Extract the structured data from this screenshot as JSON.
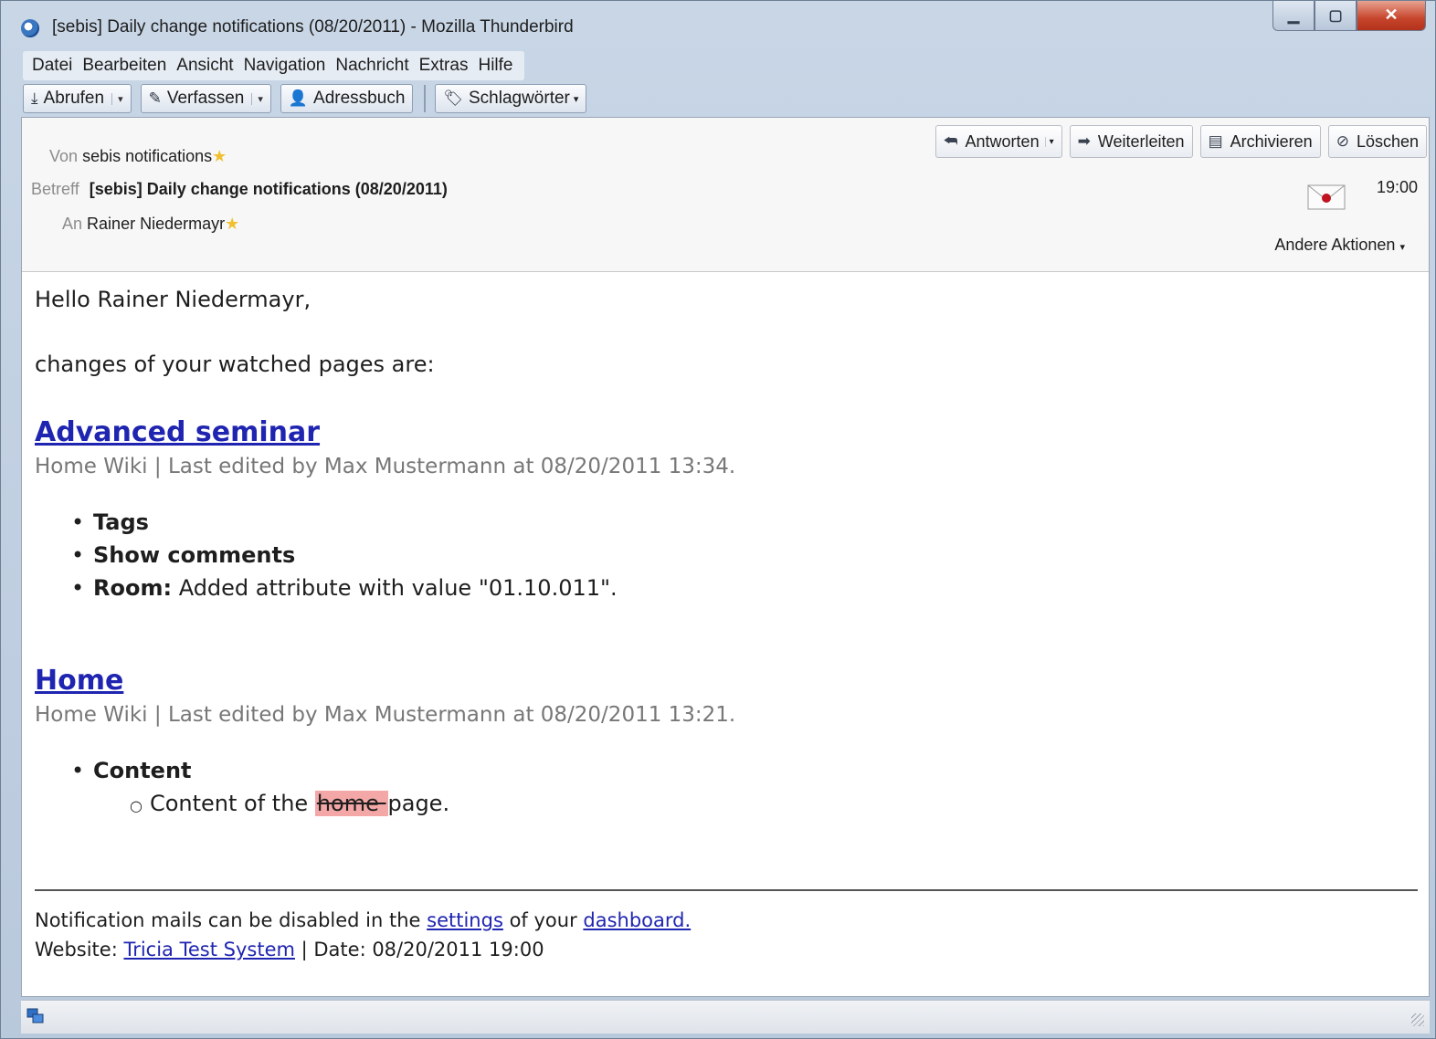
{
  "window": {
    "title": "[sebis] Daily change notifications (08/20/2011) - Mozilla Thunderbird"
  },
  "menubar": [
    "Datei",
    "Bearbeiten",
    "Ansicht",
    "Navigation",
    "Nachricht",
    "Extras",
    "Hilfe"
  ],
  "toolbar": {
    "get_mail": "Abrufen",
    "compose": "Verfassen",
    "address_book": "Adressbuch",
    "tags": "Schlagwörter"
  },
  "header": {
    "from_label": "Von",
    "from_value": "sebis notifications",
    "subject_label": "Betreff",
    "subject_value": "[sebis] Daily change notifications (08/20/2011)",
    "to_label": "An",
    "to_value": "Rainer Niedermayr",
    "time": "19:00",
    "other_actions": "Andere Aktionen"
  },
  "actions": {
    "reply": "Antworten",
    "forward": "Weiterleiten",
    "archive": "Archivieren",
    "delete": "Löschen"
  },
  "message": {
    "greeting": "Hello Rainer Niedermayr,",
    "intro": "changes of your watched pages are:",
    "sections": [
      {
        "title": "Advanced seminar",
        "meta": "Home Wiki | Last edited by Max Mustermann at 08/20/2011 13:34.",
        "items": [
          {
            "bold": "Tags",
            "text": ""
          },
          {
            "bold": "Show comments",
            "text": ""
          },
          {
            "bold": "Room:",
            "text": " Added attribute with value \"01.10.011\"."
          }
        ]
      },
      {
        "title": "Home",
        "meta": "Home Wiki | Last edited by Max Mustermann at 08/20/2011 13:21.",
        "items": [
          {
            "bold": "Content",
            "text": ""
          }
        ],
        "subitem": {
          "before": "Content of the ",
          "deleted": "home ",
          "after": "page."
        }
      }
    ],
    "footer": {
      "line1_before": "Notification mails can be disabled in the ",
      "settings_link": "settings",
      "line1_middle": " of your ",
      "dashboard_link": "dashboard.",
      "website_label": "Website: ",
      "website_link": "Tricia Test System",
      "date_text": " | Date: 08/20/2011 19:00"
    }
  },
  "colors": {
    "link": "#1f25b0",
    "deleted_highlight": "#f4a7a7",
    "meta_gray": "#777777"
  },
  "icons": [
    "thunderbird-icon",
    "minimize-icon",
    "maximize-icon",
    "close-icon",
    "download-icon",
    "pencil-icon",
    "contact-icon",
    "tag-icon",
    "reply-icon",
    "forward-icon",
    "archive-icon",
    "delete-icon",
    "star-icon",
    "envelope-icon",
    "status-icon"
  ]
}
